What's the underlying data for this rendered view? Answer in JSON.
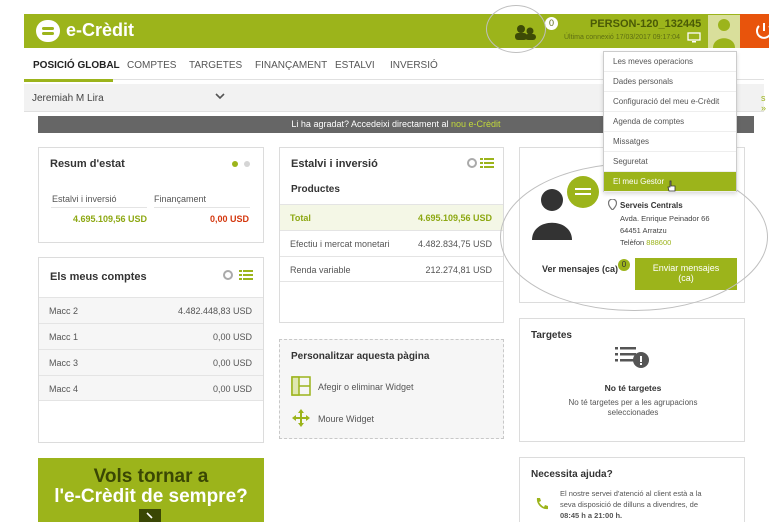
{
  "brand": {
    "name": "e-Crèdit"
  },
  "header": {
    "notification_count": "0",
    "user_name": "PERSON-120_132445",
    "last_connection": "Última connexió 17/03/2017 09:17:04",
    "colors": {
      "accent": "#9cb41b",
      "power": "#e8540c"
    }
  },
  "nav": {
    "tabs": [
      "POSICIÓ GLOBAL",
      "COMPTES",
      "TARGETES",
      "FINANÇAMENT",
      "ESTALVI",
      "INVERSIÓ"
    ],
    "active": "POSICIÓ GLOBAL"
  },
  "account": {
    "holder": "Jeremiah M Lira",
    "more_link": "s »"
  },
  "banner": {
    "text": "Li ha agradat? Accedeixi directament al ",
    "link": "nou e-Crèdit"
  },
  "resum": {
    "title": "Resum d'estat",
    "col1_label": "Estalvi i inversió",
    "col2_label": "Finançament",
    "col1_value": "4.695.109,56 USD",
    "col2_value": "0,00 USD"
  },
  "comptes": {
    "title": "Els meus comptes",
    "rows": [
      {
        "name": "Macc 2",
        "value": "4.482.448,83 USD"
      },
      {
        "name": "Macc 1",
        "value": "0,00 USD"
      },
      {
        "name": "Macc 3",
        "value": "0,00 USD"
      },
      {
        "name": "Macc 4",
        "value": "0,00 USD"
      }
    ]
  },
  "estalvi": {
    "title": "Estalvi i inversió",
    "subtitle": "Productes",
    "total_label": "Total",
    "total_value": "4.695.109,56 USD",
    "rows": [
      {
        "name": "Efectiu i mercat monetari",
        "value": "4.482.834,75 USD"
      },
      {
        "name": "Renda variable",
        "value": "212.274,81 USD"
      }
    ]
  },
  "personalitzar": {
    "title": "Personalitzar aquesta pàgina",
    "add_label": "Afegir o eliminar Widget",
    "move_label": "Moure Widget"
  },
  "promo": {
    "line1": "Vols tornar a",
    "line2": "l'e-Crèdit de sempre?"
  },
  "gestor": {
    "office": "Serveis Centrals",
    "address1": "Avda. Enrique Peinador 66",
    "address2": "64451 Arratzu",
    "phone_label": "Telèfon ",
    "phone": "888600",
    "messages_label": "Ver mensajes (ca)",
    "messages_count": "0",
    "send_label_1": "Enviar mensajes",
    "send_label_2": "(ca)"
  },
  "targetes": {
    "title": "Targetes",
    "empty_title": "No té targetes",
    "empty_text_1": "No té targetes per a les agrupacions",
    "empty_text_2": "seleccionades"
  },
  "ajuda": {
    "title": "Necessita ajuda?",
    "line1": "El nostre servei d'atenció al client està a la",
    "line2": "seva disposició de dilluns a divendres, de",
    "line3": "08:45 h a 21:00 h."
  },
  "user_menu": {
    "items": [
      "Les meves operacions",
      "Dades personals",
      "Configuració del meu e-Crèdit",
      "Agenda de comptes",
      "Missatges",
      "Seguretat",
      "El meu Gestor"
    ],
    "selected": "El meu Gestor"
  }
}
